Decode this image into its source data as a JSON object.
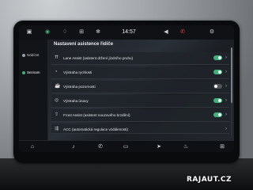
{
  "status_bar": {
    "time": "14:57",
    "left_icons": [
      "car-icon",
      "signal-icon",
      "leaf-icon",
      "grid-icon",
      "fan-icon"
    ],
    "right_icons": [
      "volume-icon",
      "phone-muted-icon",
      "settings-icon"
    ]
  },
  "sidebar": {
    "items": [
      {
        "label": "Nabízet",
        "icon": "dots-icon",
        "active": false
      },
      {
        "label": "Seznam",
        "icon": "circle-icon",
        "active": true
      }
    ]
  },
  "main": {
    "title": "Nastavení asistence řidiče",
    "rows": [
      {
        "label": "Lane Assist (asistent držení jízdního pruhu)",
        "icon": "lane-icon",
        "toggle": "on"
      },
      {
        "label": "Výstraha rychlosti",
        "icon": "speed-icon",
        "toggle": "on"
      },
      {
        "label": "Výstraha pozornosti",
        "icon": "coffee-icon",
        "toggle": "off"
      },
      {
        "label": "Výstraha únavy",
        "icon": "fatigue-icon",
        "toggle": "on"
      },
      {
        "label": "Front Assist (asistent nouzového brzdění)",
        "icon": "front-assist-icon",
        "toggle": "on"
      },
      {
        "label": "ACC (automatická regulace vzdálenosti)",
        "icon": "acc-icon",
        "toggle": null
      }
    ]
  },
  "dock": {
    "icons": [
      "home-icon",
      "music-icon",
      "phone-icon",
      "car-icon",
      "navigation-icon",
      "climate-icon",
      "apps-icon"
    ]
  },
  "watermark": "RAJAUT.CZ",
  "colors": {
    "accent": "#3fb07a",
    "toggle_off": "#50555c",
    "background": "#15181c"
  }
}
